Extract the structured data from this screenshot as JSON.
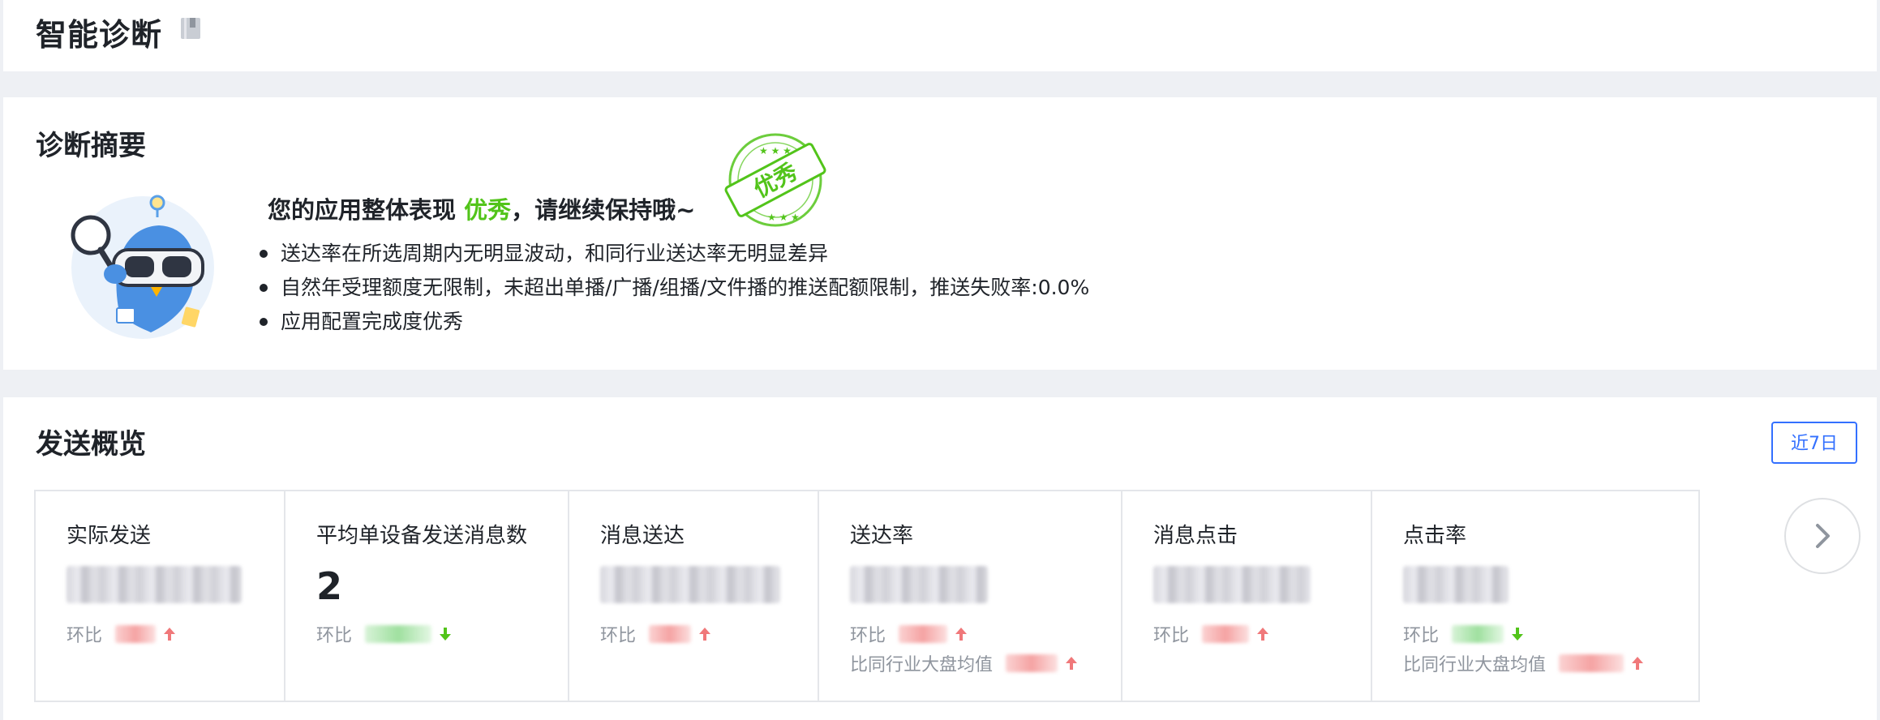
{
  "header": {
    "title": "智能诊断",
    "doc_icon": "book-icon"
  },
  "summary": {
    "title": "诊断摘要",
    "mascot_icon": "mascot-illustration",
    "headline_prefix": "您的应用整体表现",
    "grade": "优秀",
    "headline_suffix": "，请继续保持哦~",
    "stamp_text": "优秀",
    "stamp_color": "#52c41a",
    "bullets": [
      "送达率在所选周期内无明显波动，和同行业送达率无明显差异",
      "自然年受理额度无限制，未超出单播/广播/组播/文件播的推送配额限制，推送失败率:0.0%",
      "应用配置完成度优秀"
    ]
  },
  "overview": {
    "title": "发送概览",
    "range_button": "近7日",
    "next_icon": "chevron-right-icon",
    "metrics": [
      {
        "label": "实际发送",
        "value": "",
        "mom_label": "环比",
        "mom_trend": "up",
        "industry_label": ""
      },
      {
        "label": "平均单设备发送消息数",
        "value": "2",
        "mom_label": "环比",
        "mom_trend": "down",
        "industry_label": ""
      },
      {
        "label": "消息送达",
        "value": "",
        "mom_label": "环比",
        "mom_trend": "up",
        "industry_label": ""
      },
      {
        "label": "送达率",
        "value": "",
        "mom_label": "环比",
        "mom_trend": "up",
        "industry_label": "比同行业大盘均值",
        "industry_trend": "up"
      },
      {
        "label": "消息点击",
        "value": "",
        "mom_label": "环比",
        "mom_trend": "up",
        "industry_label": ""
      },
      {
        "label": "点击率",
        "value": "",
        "mom_label": "环比",
        "mom_trend": "down",
        "industry_label": "比同行业大盘均值",
        "industry_trend": "up"
      }
    ]
  },
  "colors": {
    "accent": "#3370ff",
    "up": "#f0787a",
    "down": "#52c41a",
    "excellent": "#52c41a"
  }
}
